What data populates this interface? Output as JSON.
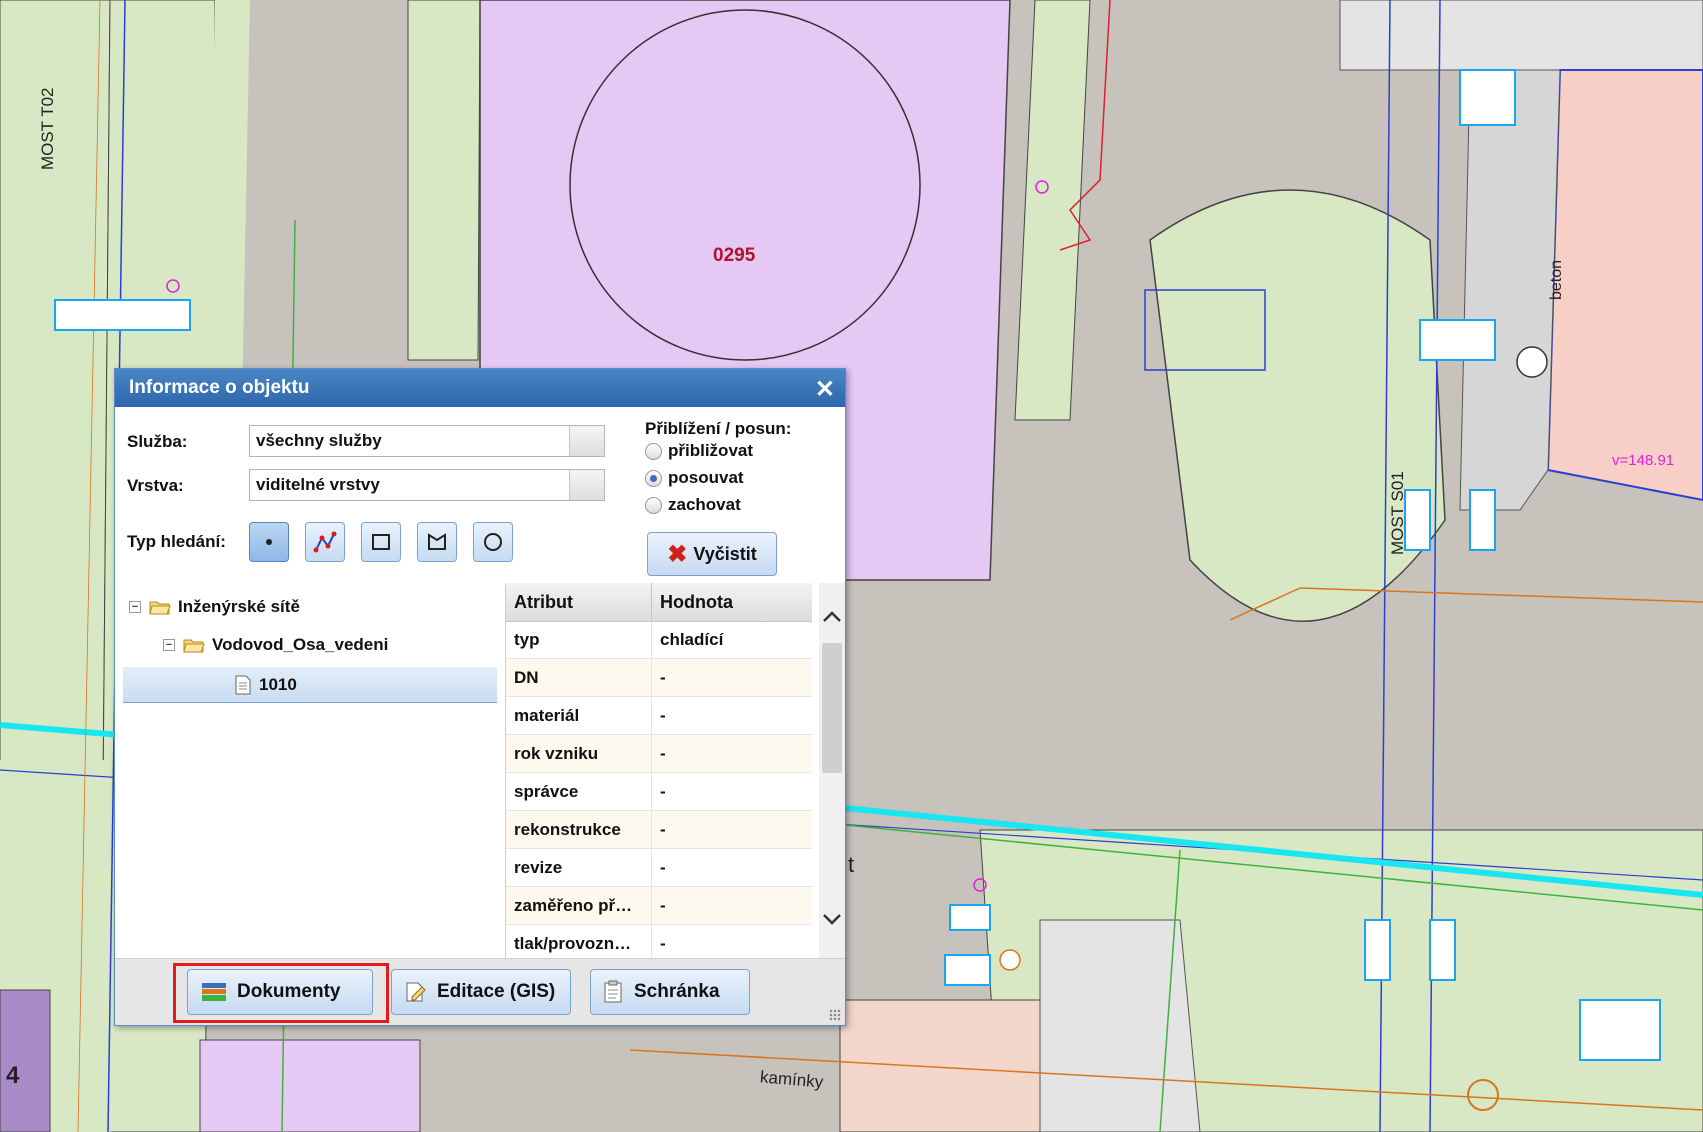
{
  "map": {
    "labels": {
      "parcel": "0295",
      "bridge_t02": "MOST T02",
      "bridge_s01": "MOST S01",
      "surface_beton": "beton",
      "surface_kaminky": "kamínky",
      "elevation": "v=148.91",
      "edge_number": "4",
      "partial_label": "t"
    },
    "colors": {
      "parcel_fill": "#e6c8f5",
      "grass_fill": "#d9e8c4",
      "road_fill": "#c8c2bd",
      "building_fill": "#f8cfc6",
      "pipe_cyan": "#19e6f0",
      "pipe_orange": "#d8751f",
      "line_green": "#3db33d",
      "line_blue": "#2c3fcf"
    }
  },
  "dialog": {
    "title": "Informace o objektu",
    "close_symbol": "✕",
    "service_label": "Služba:",
    "service_value": "všechny služby",
    "layer_label": "Vrstva:",
    "layer_value": "viditelné vrstvy",
    "search_type_label": "Typ hledání:",
    "search_types": [
      "point-tool-icon",
      "polyline-tool-icon",
      "rectangle-tool-icon",
      "polygon-tool-icon",
      "circle-tool-icon"
    ],
    "zoom_pan_label": "Přiblížení / posun:",
    "zoom_options": [
      {
        "label": "přibližovat",
        "checked": false
      },
      {
        "label": "posouvat",
        "checked": true
      },
      {
        "label": "zachovat",
        "checked": false
      }
    ],
    "clear_label": "Vyčistit",
    "tree": {
      "root": "Inženýrské sítě",
      "child": "Vodovod_Osa_vedeni",
      "leaf": "1010",
      "toggle_symbol": "−"
    },
    "grid": {
      "headers": [
        "Atribut",
        "Hodnota"
      ],
      "rows": [
        [
          "typ",
          "chladící"
        ],
        [
          "DN",
          "-"
        ],
        [
          "materiál",
          "-"
        ],
        [
          "rok vzniku",
          "-"
        ],
        [
          "správce",
          "-"
        ],
        [
          "rekonstrukce",
          "-"
        ],
        [
          "revize",
          "-"
        ],
        [
          "zaměřeno př…",
          "-"
        ],
        [
          "tlak/provozn…",
          "-"
        ]
      ]
    },
    "footer": {
      "documents_label": "Dokumenty",
      "edit_label": "Editace (GIS)",
      "clipboard_label": "Schránka"
    }
  }
}
